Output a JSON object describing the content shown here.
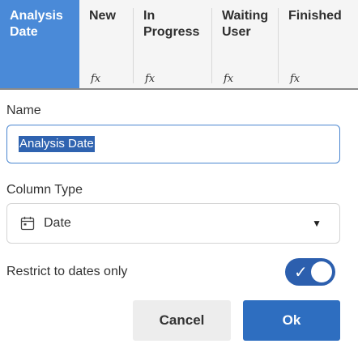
{
  "columns": [
    {
      "label": "Analysis Date",
      "active": true,
      "fx": false
    },
    {
      "label": "New",
      "active": false,
      "fx": true
    },
    {
      "label": "In Progress",
      "active": false,
      "fx": true
    },
    {
      "label": "Waiting User",
      "active": false,
      "fx": true
    },
    {
      "label": "Finished",
      "active": false,
      "fx": true
    }
  ],
  "fx_symbol": "fx",
  "form": {
    "name_label": "Name",
    "name_value": "Analysis Date",
    "column_type_label": "Column Type",
    "column_type_value": "Date",
    "column_type_icon": "calendar-icon",
    "restrict_label": "Restrict to dates only",
    "restrict_enabled": true
  },
  "buttons": {
    "cancel": "Cancel",
    "ok": "Ok"
  },
  "colors": {
    "active_header": "#4a8ad8",
    "selection": "#2f63b0",
    "toggle_on": "#2c5fae",
    "ok_button": "#2e6ec0"
  }
}
